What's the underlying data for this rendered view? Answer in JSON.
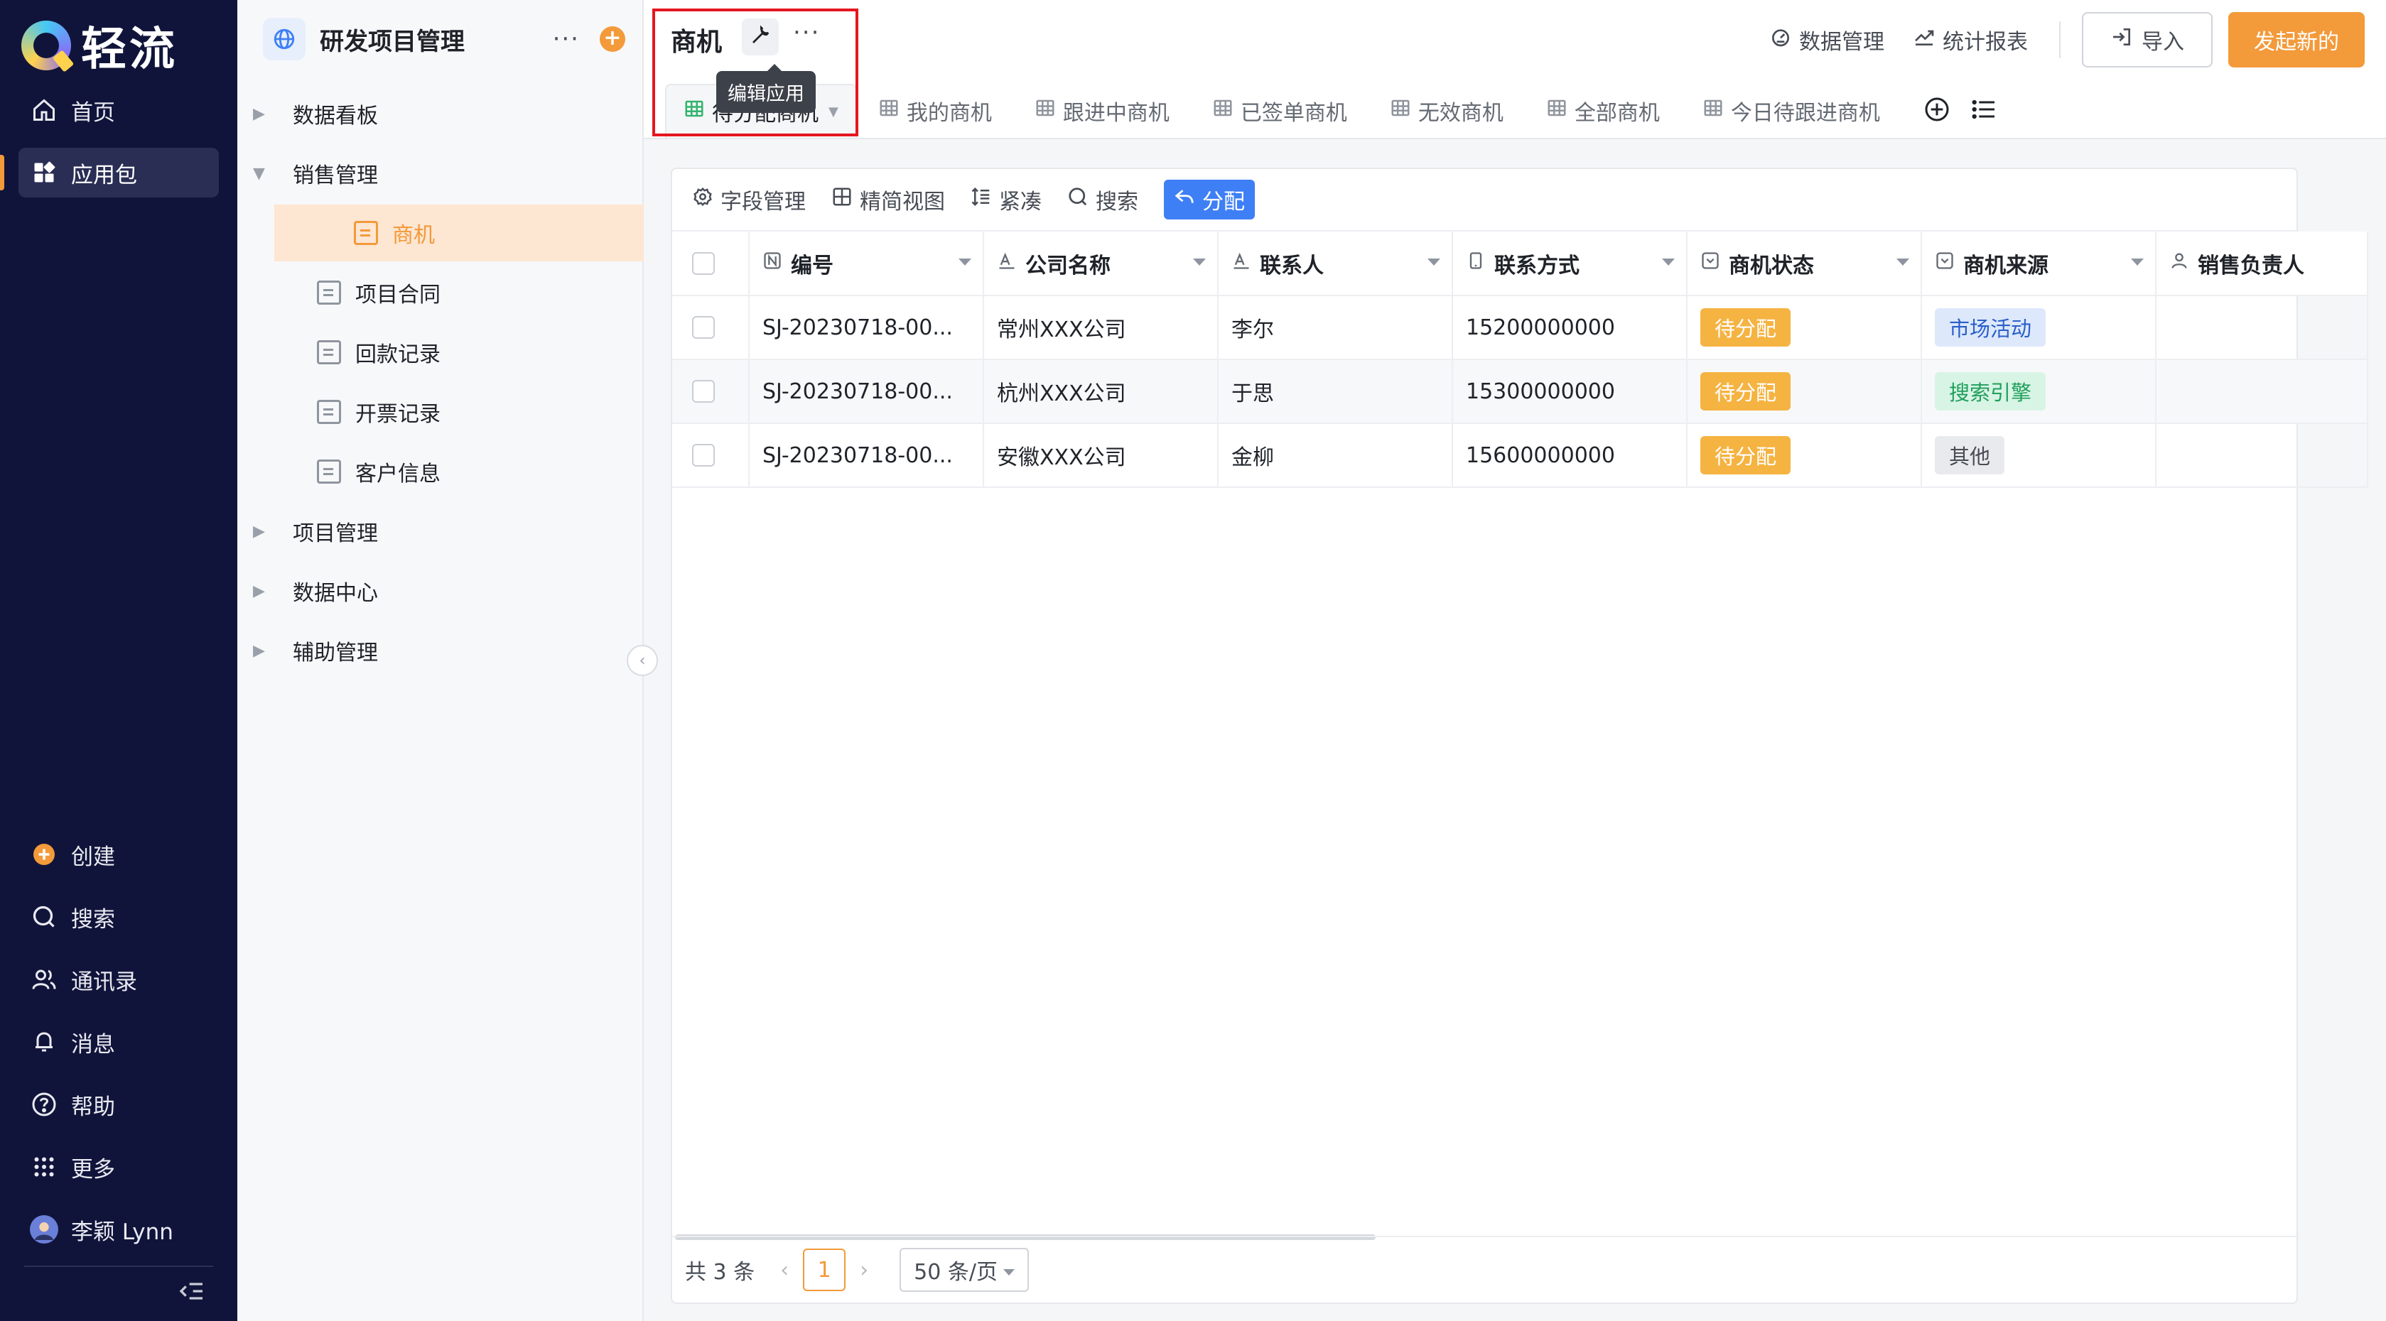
{
  "brand": {
    "name": "轻流"
  },
  "nav": {
    "top_items": [
      {
        "label": "首页",
        "icon": "home-icon"
      },
      {
        "label": "应用包",
        "icon": "apps-icon",
        "active": true
      }
    ],
    "bottom_items": [
      {
        "label": "创建",
        "icon": "plus-circle-icon"
      },
      {
        "label": "搜索",
        "icon": "search-icon"
      },
      {
        "label": "通讯录",
        "icon": "contacts-icon"
      },
      {
        "label": "消息",
        "icon": "bell-icon"
      },
      {
        "label": "帮助",
        "icon": "help-icon"
      },
      {
        "label": "更多",
        "icon": "grid-dots-icon"
      }
    ],
    "user": {
      "name": "李颖 Lynn"
    }
  },
  "sidebar": {
    "title": "研发项目管理",
    "more": "···",
    "groups": [
      {
        "label": "数据看板",
        "expanded": false
      },
      {
        "label": "销售管理",
        "expanded": true,
        "children": [
          "商机",
          "项目合同",
          "回款记录",
          "开票记录",
          "客户信息"
        ]
      },
      {
        "label": "项目管理",
        "expanded": false
      },
      {
        "label": "数据中心",
        "expanded": false
      },
      {
        "label": "辅助管理",
        "expanded": false
      }
    ],
    "active_child": "商机"
  },
  "header": {
    "title": "商机",
    "more": "···",
    "tooltip": "编辑应用",
    "actions": {
      "data_manage": "数据管理",
      "reports": "统计报表",
      "import": "导入",
      "start": "发起新的"
    }
  },
  "tabs": [
    "待分配商机",
    "我的商机",
    "跟进中商机",
    "已签单商机",
    "无效商机",
    "全部商机",
    "今日待跟进商机"
  ],
  "toolbar": {
    "fields": "字段管理",
    "view": "精简视图",
    "compact": "紧凑",
    "search": "搜索",
    "assign": "分配"
  },
  "table": {
    "columns": [
      "编号",
      "公司名称",
      "联系人",
      "联系方式",
      "商机状态",
      "商机来源",
      "销售负责人"
    ],
    "rows": [
      {
        "id": "SJ-20230718-00...",
        "company": "常州XXX公司",
        "contact": "李尔",
        "phone": "15200000000",
        "status": "待分配",
        "source": "市场活动",
        "owner": ""
      },
      {
        "id": "SJ-20230718-00...",
        "company": "杭州XXX公司",
        "contact": "于思",
        "phone": "15300000000",
        "status": "待分配",
        "source": "搜索引擎",
        "owner": ""
      },
      {
        "id": "SJ-20230718-00...",
        "company": "安徽XXX公司",
        "contact": "金柳",
        "phone": "15600000000",
        "status": "待分配",
        "source": "其他",
        "owner": ""
      }
    ]
  },
  "pagination": {
    "total": "共 3 条",
    "current": "1",
    "page_size": "50 条/页"
  },
  "colors": {
    "nav_bg": "#11143a",
    "accent": "#f39a3a",
    "primary": "#3e7ff5",
    "highlight_box": "#e5161f"
  }
}
